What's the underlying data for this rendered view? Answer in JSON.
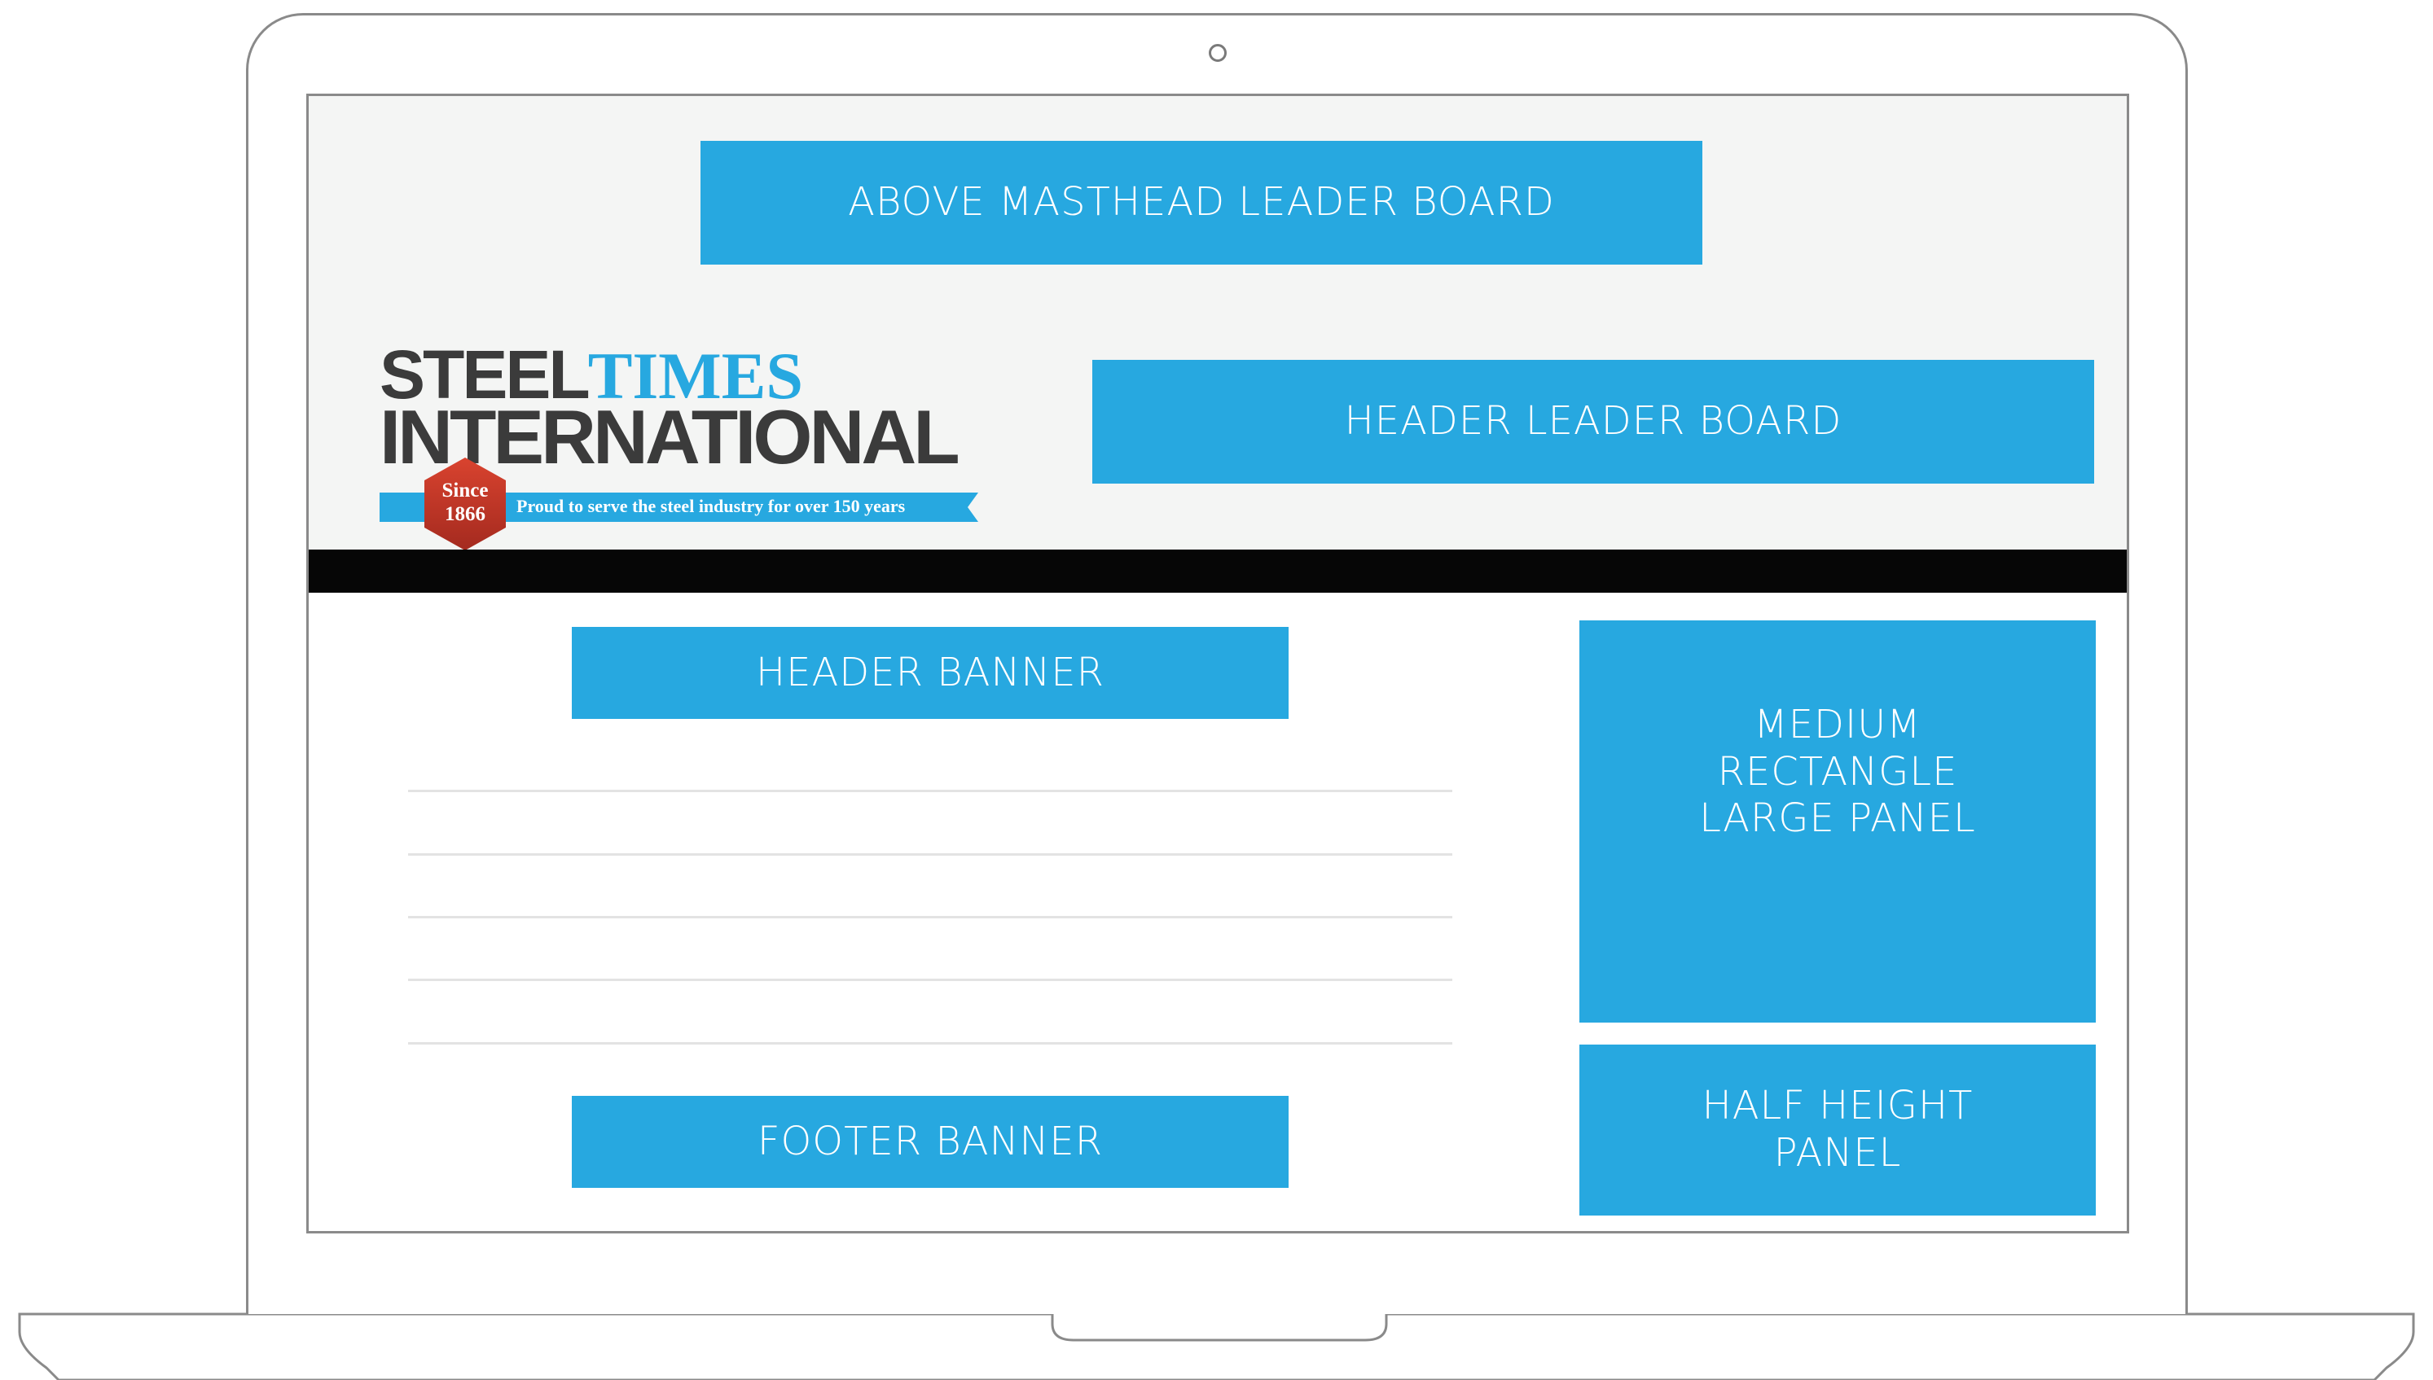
{
  "colors": {
    "ad_blue": "#27a8e0",
    "masthead_bg": "#f4f5f4",
    "nav_bar": "#060606",
    "logo_dark": "#3b3b3b",
    "logo_blue": "#27a8e0",
    "badge_red": "#c0392b"
  },
  "logo": {
    "word_steel": "STEEL",
    "word_times": "TIMES",
    "word_international": "INTERNATIONAL",
    "tagline": "Proud to serve the steel industry for over 150 years",
    "since_label": "Since",
    "since_year": "1866"
  },
  "ads": {
    "above_masthead": [
      "ABOVE MASTHEAD LEADER BOARD"
    ],
    "header_leader_board": [
      "HEADER LEADER BOARD"
    ],
    "header_banner": [
      "HEADER BANNER"
    ],
    "footer_banner": [
      "FOOTER BANNER"
    ],
    "medium_rectangle": [
      "MEDIUM",
      "RECTANGLE",
      "LARGE PANEL"
    ],
    "half_height": [
      "HALF HEIGHT",
      "PANEL"
    ]
  }
}
